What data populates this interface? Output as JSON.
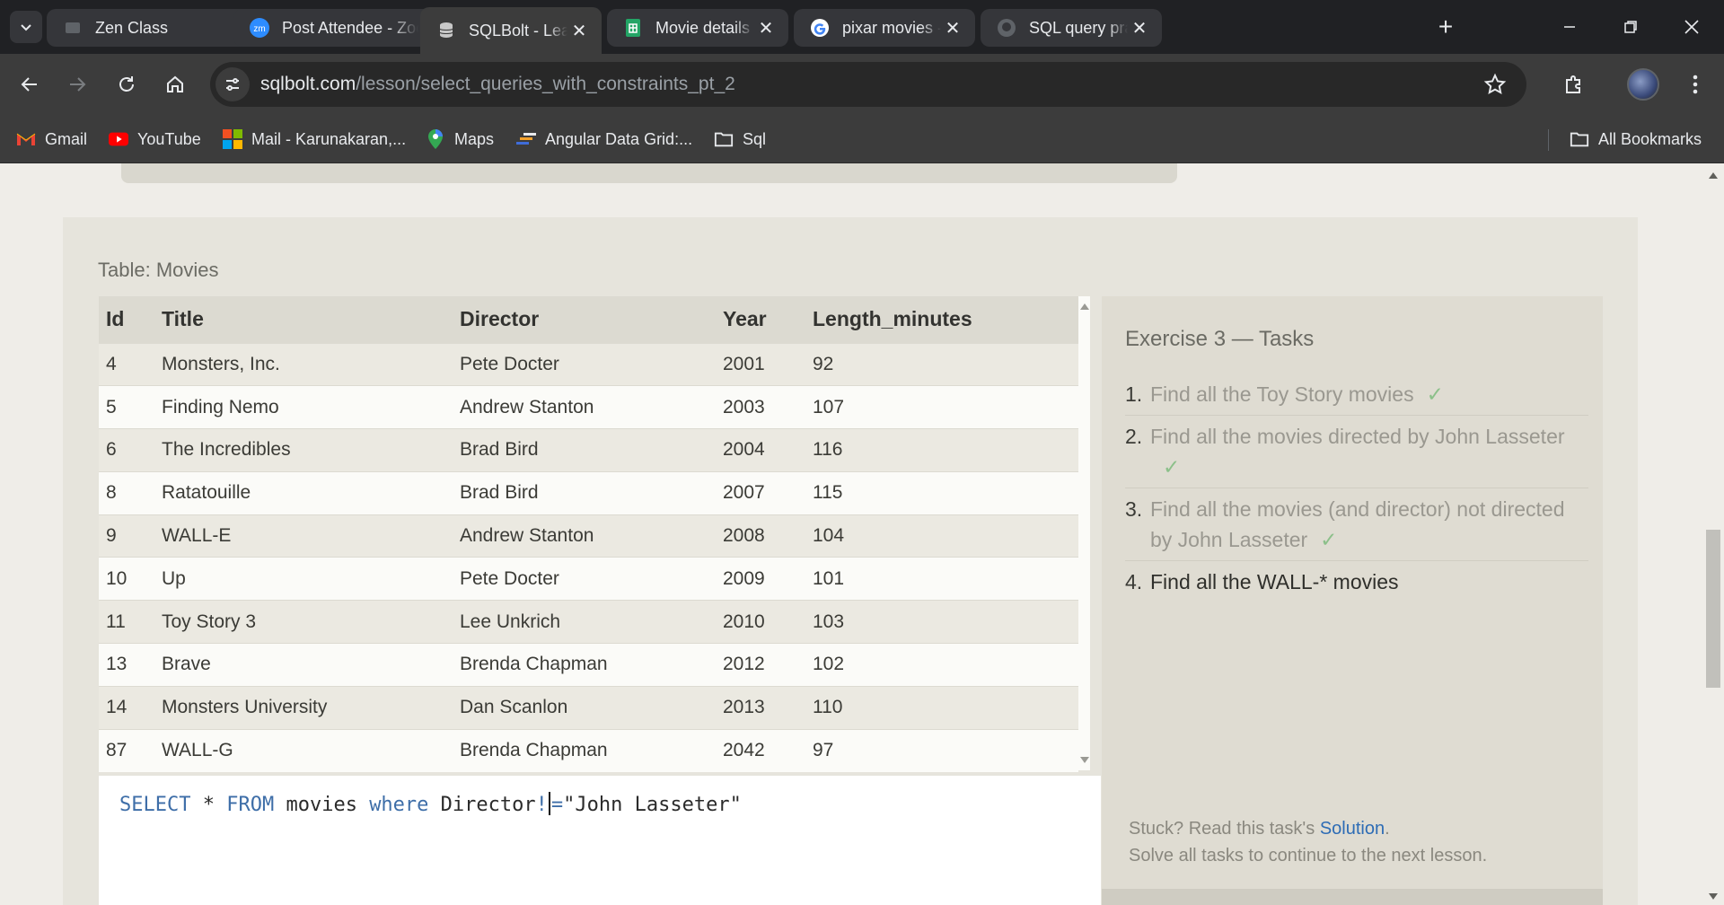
{
  "browser": {
    "tabs": [
      {
        "label": "Zen Class",
        "icon": "zen-class-icon",
        "active": false
      },
      {
        "label": "Post Attendee - Zoom",
        "icon": "zoom-icon",
        "active": false
      },
      {
        "label": "SQLBolt - Learn SQL",
        "icon": "sqlbolt-icon",
        "active": true
      },
      {
        "label": "Movie details - Google Sheets",
        "icon": "sheets-icon",
        "active": false
      },
      {
        "label": "pixar movies - Google Search",
        "icon": "google-icon",
        "active": false
      },
      {
        "label": "SQL query practice",
        "icon": "github-icon",
        "active": false
      }
    ],
    "url_domain": "sqlbolt.com",
    "url_path": "/lesson/select_queries_with_constraints_pt_2",
    "zoom_text": "zm",
    "bookmarks": [
      {
        "label": "Gmail",
        "icon": "gmail-icon"
      },
      {
        "label": "YouTube",
        "icon": "youtube-icon"
      },
      {
        "label": "Mail - Karunakaran,...",
        "icon": "microsoft-icon"
      },
      {
        "label": "Maps",
        "icon": "maps-icon"
      },
      {
        "label": "Angular Data Grid:...",
        "icon": "ag-grid-icon"
      },
      {
        "label": "Sql",
        "icon": "folder-icon"
      }
    ],
    "all_bookmarks": "All Bookmarks"
  },
  "lesson": {
    "table_caption": "Table: Movies",
    "columns": [
      "Id",
      "Title",
      "Director",
      "Year",
      "Length_minutes"
    ],
    "rows": [
      [
        "4",
        "Monsters, Inc.",
        "Pete Docter",
        "2001",
        "92"
      ],
      [
        "5",
        "Finding Nemo",
        "Andrew Stanton",
        "2003",
        "107"
      ],
      [
        "6",
        "The Incredibles",
        "Brad Bird",
        "2004",
        "116"
      ],
      [
        "8",
        "Ratatouille",
        "Brad Bird",
        "2007",
        "115"
      ],
      [
        "9",
        "WALL-E",
        "Andrew Stanton",
        "2008",
        "104"
      ],
      [
        "10",
        "Up",
        "Pete Docter",
        "2009",
        "101"
      ],
      [
        "11",
        "Toy Story 3",
        "Lee Unkrich",
        "2010",
        "103"
      ],
      [
        "13",
        "Brave",
        "Brenda Chapman",
        "2012",
        "102"
      ],
      [
        "14",
        "Monsters University",
        "Dan Scanlon",
        "2013",
        "110"
      ],
      [
        "87",
        "WALL-G",
        "Brenda Chapman",
        "2042",
        "97"
      ]
    ],
    "query": {
      "select": "SELECT",
      "star": " * ",
      "from": "FROM",
      "table": " movies ",
      "where": "where",
      "column": " Director",
      "op_before_caret": "!",
      "op_after_caret": "=",
      "value": "\"John Lasseter\""
    },
    "tasks": {
      "title": "Exercise 3 — Tasks",
      "items": [
        {
          "num": "1.",
          "text": "Find all the Toy Story movies",
          "done": true
        },
        {
          "num": "2.",
          "text": "Find all the movies directed by John Lasseter",
          "done": true
        },
        {
          "num": "3.",
          "text": "Find all the movies (and director) not directed by John Lasseter",
          "done": true
        },
        {
          "num": "4.",
          "text": "Find all the WALL-* movies",
          "done": false
        }
      ],
      "check_mark": "✓",
      "stuck_prefix": "Stuck? Read this task's ",
      "solution_link": "Solution",
      "stuck_suffix": ".",
      "continue_text": "Solve all tasks to continue to the next lesson."
    }
  },
  "colors": {
    "accent_link": "#2d6cb5",
    "check": "#8cc08a",
    "keyword": "#3e6ea8"
  }
}
